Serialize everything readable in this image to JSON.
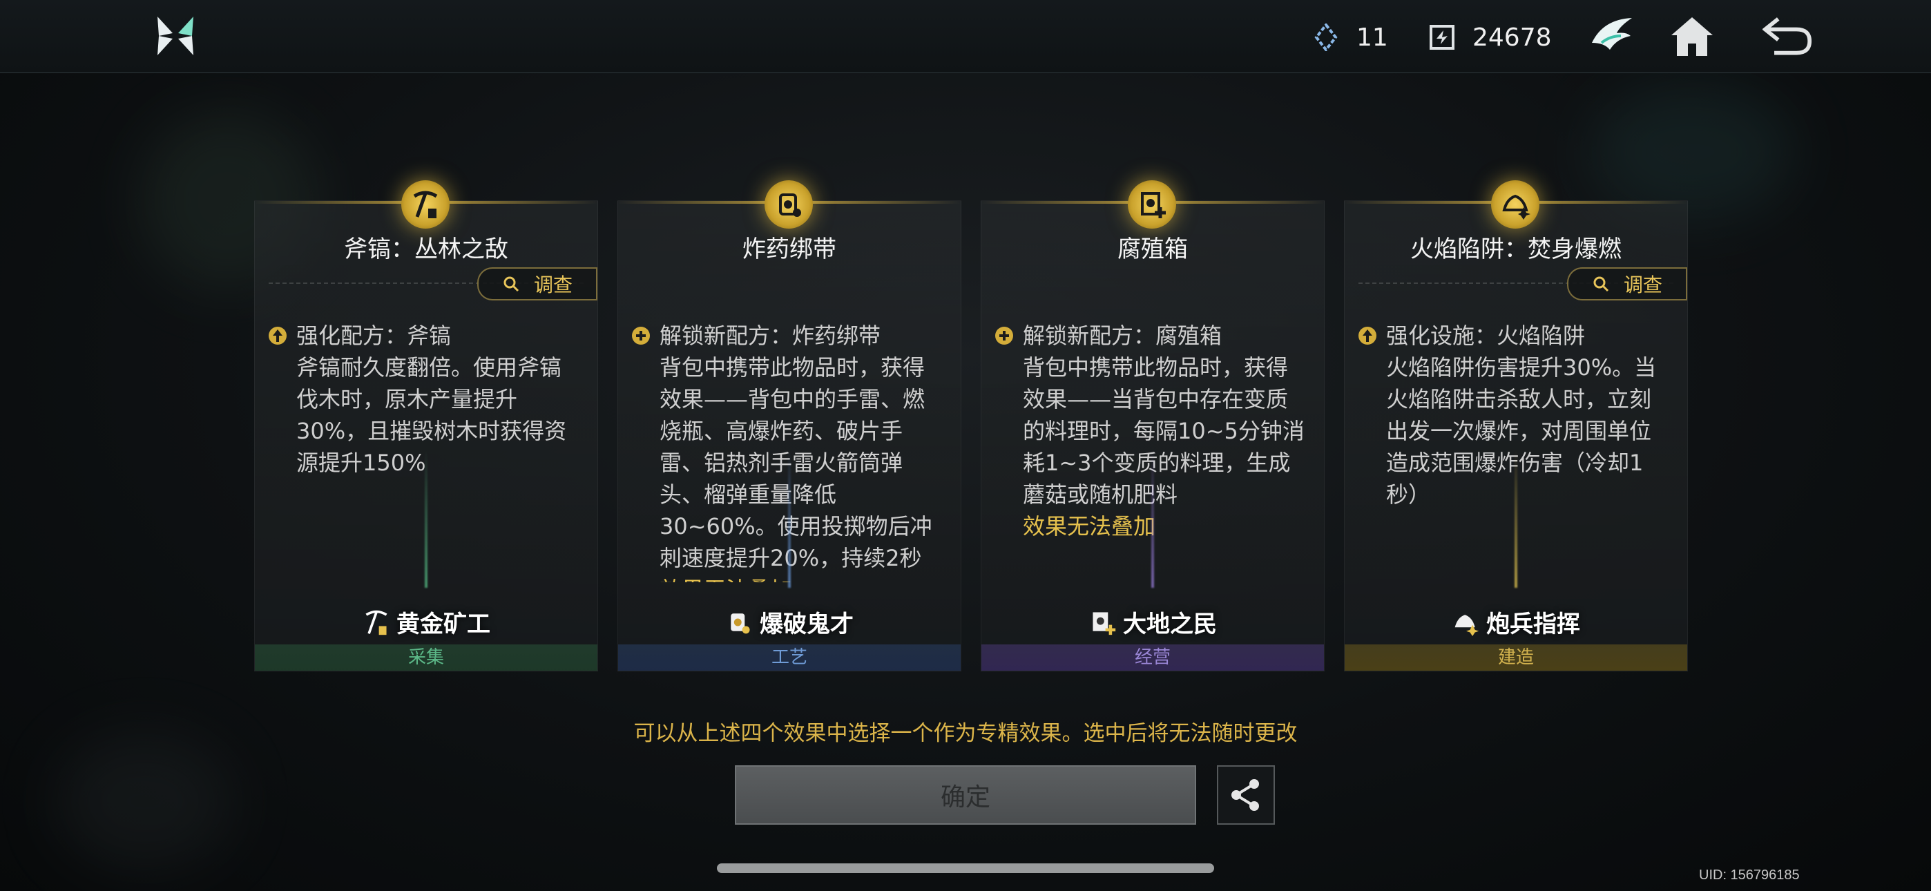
{
  "header": {
    "resources": [
      {
        "icon": "crystal-icon",
        "value": "11"
      },
      {
        "icon": "coin-icon",
        "value": "24678"
      }
    ],
    "buttons": {
      "guild": "wing-emblem-icon",
      "home": "home-icon",
      "back": "back-arrow-icon"
    }
  },
  "cards": [
    {
      "title": "斧镐：丛林之敌",
      "has_investigate": true,
      "investigate_label": "调查",
      "effect_type": "upgrade",
      "lines": [
        "强化配方：斧镐",
        "斧镐耐久度翻倍。使用斧镐伐木时，原木产量提升30%，且摧毁树木时获得资源提升150%"
      ],
      "highlight": "",
      "skill_name": "黄金矿工",
      "category": "采集",
      "accent": "#3f9a6e"
    },
    {
      "title": "炸药绑带",
      "has_investigate": false,
      "investigate_label": "",
      "effect_type": "unlock",
      "lines": [
        "解锁新配方：炸药绑带",
        "背包中携带此物品时，获得效果——背包中的手雷、燃烧瓶、高爆炸药、破片手雷、铝热剂手雷火箭筒弹头、榴弹重量降低30~60%。使用投掷物后冲刺速度提升20%，持续2秒"
      ],
      "highlight": "效果无法叠加",
      "skill_name": "爆破鬼才",
      "category": "工艺",
      "accent": "#4a78b5"
    },
    {
      "title": "腐殖箱",
      "has_investigate": false,
      "investigate_label": "",
      "effect_type": "unlock",
      "lines": [
        "解锁新配方：腐殖箱",
        "背包中携带此物品时，获得效果——当背包中存在变质的料理时，每隔10~5分钟消耗1~3个变质的料理，生成蘑菇或随机肥料"
      ],
      "highlight": "效果无法叠加",
      "skill_name": "大地之民",
      "category": "经营",
      "accent": "#7a64b8"
    },
    {
      "title": "火焰陷阱：焚身爆燃",
      "has_investigate": true,
      "investigate_label": "调查",
      "effect_type": "upgrade",
      "lines": [
        "强化设施：火焰陷阱",
        "火焰陷阱伤害提升30%。当火焰陷阱击杀敌人时，立刻出发一次爆炸，对周围单位造成范围爆炸伤害（冷却1秒）"
      ],
      "highlight": "",
      "skill_name": "炮兵指挥",
      "category": "建造",
      "accent": "#b89a2e"
    }
  ],
  "notice": "可以从上述四个效果中选择一个作为专精效果。选中后将无法随时更改",
  "confirm_label": "确定",
  "uid": "UID: 156796185"
}
